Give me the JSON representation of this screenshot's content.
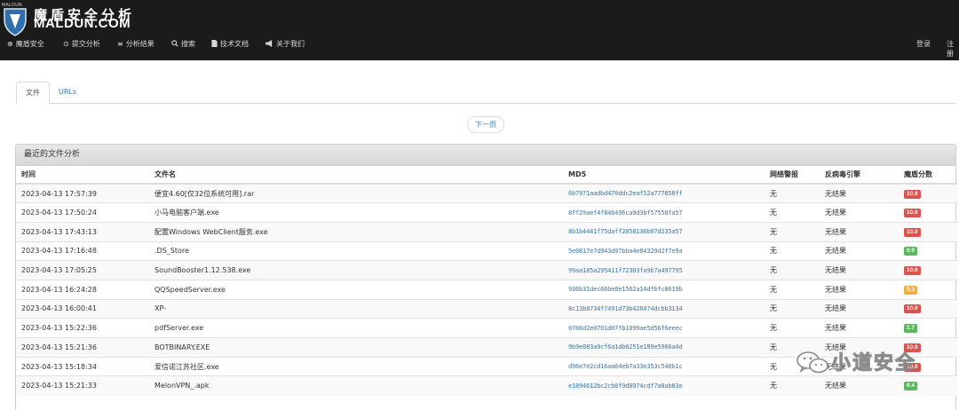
{
  "header": {
    "logo_tiny": "MALDUN",
    "brand_cn": "魔盾安全分析",
    "brand_en": "MALDUN.COM",
    "nav": [
      {
        "label": "魔盾安全",
        "icon": "circle-info-icon"
      },
      {
        "label": "提交分析",
        "icon": "upload-circle-icon"
      },
      {
        "label": "分析结果",
        "icon": "list-icon"
      },
      {
        "label": "搜索",
        "icon": "search-icon"
      },
      {
        "label": "技术文档",
        "icon": "document-icon"
      },
      {
        "label": "关于我们",
        "icon": "megaphone-icon"
      }
    ],
    "login": "登录",
    "register": "注册"
  },
  "tabs": [
    {
      "label": "文件",
      "active": true
    },
    {
      "label": "URLs",
      "active": false
    }
  ],
  "pager": {
    "next": "下一页"
  },
  "panel": {
    "title": "最近的文件分析",
    "columns": [
      "时间",
      "文件名",
      "MD5",
      "网络警报",
      "反病毒引擎",
      "魔盾分数"
    ],
    "rows": [
      {
        "time": "2023-04-13 17:57:39",
        "name": "便宜4.60[仅32位系统可用].rar",
        "md5": "6b7971aadbd470ddc2eaf52a777858ff",
        "alert": "无",
        "av": "无结果",
        "score": "10.0",
        "color": "#d9534f"
      },
      {
        "time": "2023-04-13 17:50:24",
        "name": "小马电脑客户端.exe",
        "md5": "8ff29aef4f846496ca9d3bf57558fa57",
        "alert": "无",
        "av": "无结果",
        "score": "10.0",
        "color": "#d9534f"
      },
      {
        "time": "2023-04-13 17:43:13",
        "name": "配置Windows WebClient服务.exe",
        "md5": "8b1b4441f75daff2858136b07d235a57",
        "alert": "无",
        "av": "无结果",
        "score": "10.0",
        "color": "#d9534f"
      },
      {
        "time": "2023-04-13 17:16:48",
        "name": ".DS_Store",
        "md5": "5e0817e7d943d97bba4e84329d2f7e9a",
        "alert": "无",
        "av": "无结果",
        "score": "0.0",
        "color": "#5cb85c"
      },
      {
        "time": "2023-04-13 17:05:25",
        "name": "SoundBooster1.12.538.exe",
        "md5": "99aa185a295411f72303fa9b7a497795",
        "alert": "无",
        "av": "无结果",
        "score": "10.0",
        "color": "#d9534f"
      },
      {
        "time": "2023-04-13 16:24:28",
        "name": "QQSpeedServer.exe",
        "md5": "936b31dec66be8e1562a14dfbfc8619b",
        "alert": "无",
        "av": "无结果",
        "score": "5.3",
        "color": "#f0ad4e"
      },
      {
        "time": "2023-04-13 16:00:41",
        "name": "XP-",
        "md5": "8c13b8734f7491d73b428474dcbb3134",
        "alert": "无",
        "av": "无结果",
        "score": "10.0",
        "color": "#d9534f"
      },
      {
        "time": "2023-04-13 15:22:36",
        "name": "pdfServer.exe",
        "md5": "0766d2e0701d07fb1099ae5d56f6eeec",
        "alert": "无",
        "av": "无结果",
        "score": "1.7",
        "color": "#5cb85c"
      },
      {
        "time": "2023-04-13 15:21:36",
        "name": "BOTBINARY.EXE",
        "md5": "9b9e083a9cf6a1db6251e189e5966a4d",
        "alert": "无",
        "av": "无结果",
        "score": "10.0",
        "color": "#d9534f"
      },
      {
        "time": "2023-04-13 15:18:34",
        "name": "爱信诺江苏社区.exe",
        "md5": "d96e7e2cd16aa64eb7a33e353c540b1c",
        "alert": "无",
        "av": "无结果",
        "score": "10.0",
        "color": "#d9534f"
      },
      {
        "time": "2023-04-13 15:21:33",
        "name": "MelonVPN_.apk",
        "md5": "e1894612bc2cb8f9d8974cdf7a8ab83e",
        "alert": "无",
        "av": "无结果",
        "score": "0.4",
        "color": "#5cb85c"
      }
    ]
  },
  "watermark": {
    "text": "小道安全",
    "icon": "wechat-icon"
  }
}
